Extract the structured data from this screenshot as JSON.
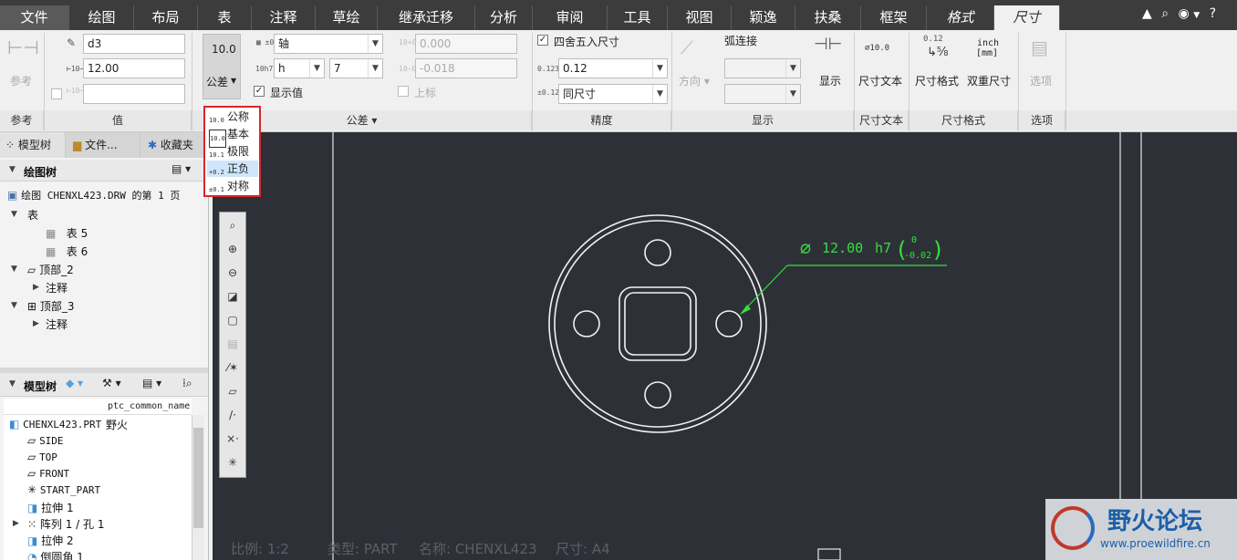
{
  "tabs": [
    {
      "label": "文件",
      "left": 0
    },
    {
      "label": "绘图"
    },
    {
      "label": "布局"
    },
    {
      "label": "表"
    },
    {
      "label": "注释"
    },
    {
      "label": "草绘"
    },
    {
      "label": "继承迁移"
    },
    {
      "label": "分析"
    },
    {
      "label": "审阅"
    },
    {
      "label": "工具"
    },
    {
      "label": "视图"
    },
    {
      "label": "颖逸"
    },
    {
      "label": "扶桑"
    },
    {
      "label": "框架"
    },
    {
      "label": "格式"
    },
    {
      "label": "尺寸"
    }
  ],
  "ribbon": {
    "reference": {
      "button": "参考",
      "group": "参考"
    },
    "value": {
      "name": "d3",
      "value": "12.00",
      "extra": "",
      "group": "值"
    },
    "tolerance": {
      "display_value": "10.0",
      "button": "公差",
      "fit_type": "轴",
      "fit_letter": "h",
      "fit_grade": "7",
      "show_value": "显示值",
      "upper": "0.000",
      "lower": "-0.018",
      "upper_label": "上标",
      "group": "公差"
    },
    "precision": {
      "round": "四舍五入尺寸",
      "value": "0.12",
      "tol_precision": "同尺寸",
      "group": "精度"
    },
    "display": {
      "direction": "方向",
      "arc": "弧连接",
      "show": "显示",
      "group": "显示"
    },
    "dim_text": {
      "button": "尺寸文本",
      "group": "尺寸文本",
      "icon_text": "⌀10.0"
    },
    "dim_format": {
      "fraction": "0.12",
      "inch": "inch",
      "mm": "[mm]",
      "button": "尺寸格式",
      "dual": "双重尺寸",
      "group": "尺寸格式"
    },
    "options": {
      "button": "选项",
      "group": "选项"
    }
  },
  "tolerance_menu": [
    {
      "icon": "10.0",
      "label": "公称"
    },
    {
      "icon": "10.0",
      "label": "基本"
    },
    {
      "icon": "10.1",
      "label": "极限"
    },
    {
      "icon": "+0.2",
      "label": "正负"
    },
    {
      "icon": "±0.1",
      "label": "对称"
    }
  ],
  "panel": {
    "tabs": [
      "模型树",
      "文件...",
      "收藏夹"
    ],
    "drawing_tree": {
      "title": "绘图树",
      "sheet": "绘图 CHENXL423.DRW 的第 1 页",
      "items": [
        "表",
        "表 5",
        "表 6",
        "顶部_2",
        "注释",
        "顶部_3",
        "注释"
      ]
    },
    "model_tree": {
      "title": "模型树",
      "column": "ptc_common_name",
      "part": "CHENXL423.PRT",
      "part_name": "野火",
      "items": [
        "SIDE",
        "TOP",
        "FRONT",
        "START_PART",
        "拉伸 1",
        "阵列 1 / 孔 1",
        "拉伸 2",
        "倒圆角 1"
      ]
    }
  },
  "drawing": {
    "dim_symbol": "∅",
    "dim_value": "12.00",
    "dim_fit": "h7",
    "tol_upper": "0",
    "tol_lower": "-0.02"
  },
  "status": {
    "scale": "比例: 1:2",
    "type": "类型: PART",
    "name": "名称: CHENXL423",
    "size": "尺寸: A4"
  },
  "watermark": {
    "title": "野火论坛",
    "url": "www.proewildfire.cn"
  }
}
